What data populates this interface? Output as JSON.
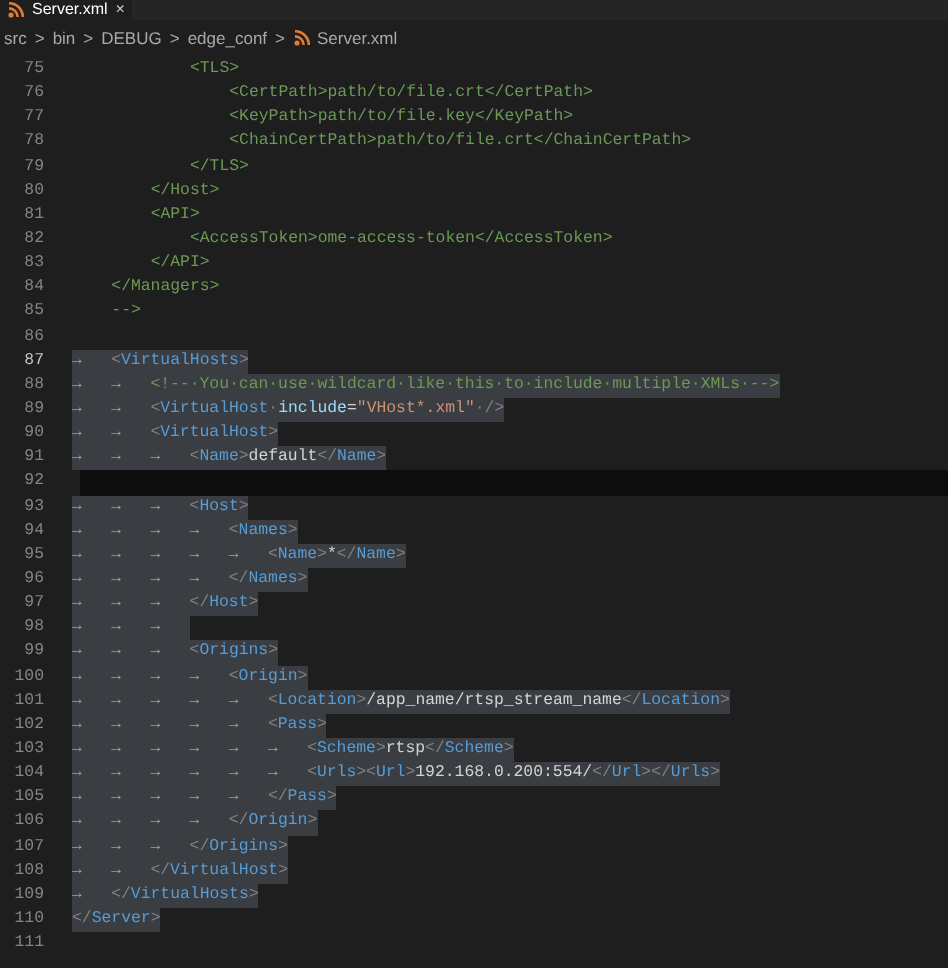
{
  "tab": {
    "label": "Server.xml",
    "close": "×"
  },
  "breadcrumb": {
    "parts": [
      "src",
      "bin",
      "DEBUG",
      "edge_conf"
    ],
    "separator": ">",
    "file": "Server.xml"
  },
  "editor": {
    "lines": [
      {
        "number": "75",
        "selected": false,
        "active": false,
        "highlighted": false,
        "segments": [
          {
            "kind": "comment",
            "text": "\t\t\t<TLS>"
          }
        ]
      },
      {
        "number": "76",
        "selected": false,
        "active": false,
        "highlighted": false,
        "segments": [
          {
            "kind": "comment",
            "text": "\t\t\t\t<CertPath>path/to/file.crt</CertPath>"
          }
        ]
      },
      {
        "number": "77",
        "selected": false,
        "active": false,
        "highlighted": false,
        "segments": [
          {
            "kind": "comment",
            "text": "\t\t\t\t<KeyPath>path/to/file.key</KeyPath>"
          }
        ]
      },
      {
        "number": "78",
        "selected": false,
        "active": false,
        "highlighted": false,
        "segments": [
          {
            "kind": "comment",
            "text": "\t\t\t\t<ChainCertPath>path/to/file.crt</ChainCertPath>"
          }
        ]
      },
      {
        "number": "79",
        "selected": false,
        "active": false,
        "highlighted": false,
        "segments": [
          {
            "kind": "comment",
            "text": "\t\t\t</TLS>"
          }
        ]
      },
      {
        "number": "80",
        "selected": false,
        "active": false,
        "highlighted": false,
        "segments": [
          {
            "kind": "comment",
            "text": "\t\t</Host>"
          }
        ]
      },
      {
        "number": "81",
        "selected": false,
        "active": false,
        "highlighted": false,
        "segments": [
          {
            "kind": "comment",
            "text": "\t\t<API>"
          }
        ]
      },
      {
        "number": "82",
        "selected": false,
        "active": false,
        "highlighted": false,
        "segments": [
          {
            "kind": "comment",
            "text": "\t\t\t<AccessToken>ome-access-token</AccessToken>"
          }
        ]
      },
      {
        "number": "83",
        "selected": false,
        "active": false,
        "highlighted": false,
        "segments": [
          {
            "kind": "comment",
            "text": "\t\t</API>"
          }
        ]
      },
      {
        "number": "84",
        "selected": false,
        "active": false,
        "highlighted": false,
        "segments": [
          {
            "kind": "comment",
            "text": "\t</Managers>"
          }
        ]
      },
      {
        "number": "85",
        "selected": false,
        "active": false,
        "highlighted": false,
        "segments": [
          {
            "kind": "comment",
            "text": "\t-->"
          }
        ]
      },
      {
        "number": "86",
        "selected": false,
        "active": false,
        "highlighted": false
      },
      {
        "number": "87",
        "selected": true,
        "active": true,
        "highlighted": false,
        "segments": [
          {
            "kind": "tab",
            "text": "→"
          },
          {
            "kind": "punct",
            "text": "<"
          },
          {
            "kind": "tag",
            "text": "VirtualHosts"
          },
          {
            "kind": "punct",
            "text": ">"
          }
        ]
      },
      {
        "number": "88",
        "selected": true,
        "active": false,
        "highlighted": false,
        "segments": [
          {
            "kind": "tab",
            "text": "→"
          },
          {
            "kind": "tab",
            "text": "→"
          },
          {
            "kind": "comment",
            "text": "<!--·You·can·use·wildcard·like·this·to·include·multiple·XMLs·-->"
          }
        ]
      },
      {
        "number": "89",
        "selected": true,
        "active": false,
        "highlighted": false,
        "segments": [
          {
            "kind": "tab",
            "text": "→"
          },
          {
            "kind": "tab",
            "text": "→"
          },
          {
            "kind": "punct",
            "text": "<"
          },
          {
            "kind": "tag",
            "text": "VirtualHost"
          },
          {
            "kind": "punct",
            "text": "·"
          },
          {
            "kind": "attr",
            "text": "include"
          },
          {
            "kind": "text",
            "text": "="
          },
          {
            "kind": "string",
            "text": "\"VHost*.xml\""
          },
          {
            "kind": "punct",
            "text": "·/>"
          }
        ]
      },
      {
        "number": "90",
        "selected": true,
        "active": false,
        "highlighted": false,
        "segments": [
          {
            "kind": "tab",
            "text": "→"
          },
          {
            "kind": "tab",
            "text": "→"
          },
          {
            "kind": "punct",
            "text": "<"
          },
          {
            "kind": "tag",
            "text": "VirtualHost"
          },
          {
            "kind": "punct",
            "text": ">"
          }
        ]
      },
      {
        "number": "91",
        "selected": true,
        "active": false,
        "highlighted": false,
        "segments": [
          {
            "kind": "tab",
            "text": "→"
          },
          {
            "kind": "tab",
            "text": "→"
          },
          {
            "kind": "tab",
            "text": "→"
          },
          {
            "kind": "punct",
            "text": "<"
          },
          {
            "kind": "tag",
            "text": "Name"
          },
          {
            "kind": "punct",
            "text": ">"
          },
          {
            "kind": "text",
            "text": "default"
          },
          {
            "kind": "punct",
            "text": "</"
          },
          {
            "kind": "tag",
            "text": "Name"
          },
          {
            "kind": "punct",
            "text": ">"
          }
        ]
      },
      {
        "number": "92",
        "selected": false,
        "active": false,
        "highlighted": true
      },
      {
        "number": "93",
        "selected": true,
        "active": false,
        "highlighted": false,
        "segments": [
          {
            "kind": "tab",
            "text": "→"
          },
          {
            "kind": "tab",
            "text": "→"
          },
          {
            "kind": "tab",
            "text": "→"
          },
          {
            "kind": "punct",
            "text": "<"
          },
          {
            "kind": "tag",
            "text": "Host"
          },
          {
            "kind": "punct",
            "text": ">"
          }
        ]
      },
      {
        "number": "94",
        "selected": true,
        "active": false,
        "highlighted": false,
        "segments": [
          {
            "kind": "tab",
            "text": "→"
          },
          {
            "kind": "tab",
            "text": "→"
          },
          {
            "kind": "tab",
            "text": "→"
          },
          {
            "kind": "tab",
            "text": "→"
          },
          {
            "kind": "punct",
            "text": "<"
          },
          {
            "kind": "tag",
            "text": "Names"
          },
          {
            "kind": "punct",
            "text": ">"
          }
        ]
      },
      {
        "number": "95",
        "selected": true,
        "active": false,
        "highlighted": false,
        "segments": [
          {
            "kind": "tab",
            "text": "→"
          },
          {
            "kind": "tab",
            "text": "→"
          },
          {
            "kind": "tab",
            "text": "→"
          },
          {
            "kind": "tab",
            "text": "→"
          },
          {
            "kind": "tab",
            "text": "→"
          },
          {
            "kind": "punct",
            "text": "<"
          },
          {
            "kind": "tag",
            "text": "Name"
          },
          {
            "kind": "punct",
            "text": ">"
          },
          {
            "kind": "text",
            "text": "*"
          },
          {
            "kind": "punct",
            "text": "</"
          },
          {
            "kind": "tag",
            "text": "Name"
          },
          {
            "kind": "punct",
            "text": ">"
          }
        ]
      },
      {
        "number": "96",
        "selected": true,
        "active": false,
        "highlighted": false,
        "segments": [
          {
            "kind": "tab",
            "text": "→"
          },
          {
            "kind": "tab",
            "text": "→"
          },
          {
            "kind": "tab",
            "text": "→"
          },
          {
            "kind": "tab",
            "text": "→"
          },
          {
            "kind": "punct",
            "text": "</"
          },
          {
            "kind": "tag",
            "text": "Names"
          },
          {
            "kind": "punct",
            "text": ">"
          }
        ]
      },
      {
        "number": "97",
        "selected": true,
        "active": false,
        "highlighted": false,
        "segments": [
          {
            "kind": "tab",
            "text": "→"
          },
          {
            "kind": "tab",
            "text": "→"
          },
          {
            "kind": "tab",
            "text": "→"
          },
          {
            "kind": "punct",
            "text": "</"
          },
          {
            "kind": "tag",
            "text": "Host"
          },
          {
            "kind": "punct",
            "text": ">"
          }
        ]
      },
      {
        "number": "98",
        "selected": true,
        "active": false,
        "highlighted": false,
        "segments": [
          {
            "kind": "tab",
            "text": "→"
          },
          {
            "kind": "tab",
            "text": "→"
          },
          {
            "kind": "tab",
            "text": "→"
          }
        ]
      },
      {
        "number": "99",
        "selected": true,
        "active": false,
        "highlighted": false,
        "segments": [
          {
            "kind": "tab",
            "text": "→"
          },
          {
            "kind": "tab",
            "text": "→"
          },
          {
            "kind": "tab",
            "text": "→"
          },
          {
            "kind": "punct",
            "text": "<"
          },
          {
            "kind": "tag",
            "text": "Origins"
          },
          {
            "kind": "punct",
            "text": ">"
          }
        ]
      },
      {
        "number": "100",
        "selected": true,
        "active": false,
        "highlighted": false,
        "segments": [
          {
            "kind": "tab",
            "text": "→"
          },
          {
            "kind": "tab",
            "text": "→"
          },
          {
            "kind": "tab",
            "text": "→"
          },
          {
            "kind": "tab",
            "text": "→"
          },
          {
            "kind": "punct",
            "text": "<"
          },
          {
            "kind": "tag",
            "text": "Origin"
          },
          {
            "kind": "punct",
            "text": ">"
          }
        ]
      },
      {
        "number": "101",
        "selected": true,
        "active": false,
        "highlighted": false,
        "segments": [
          {
            "kind": "tab",
            "text": "→"
          },
          {
            "kind": "tab",
            "text": "→"
          },
          {
            "kind": "tab",
            "text": "→"
          },
          {
            "kind": "tab",
            "text": "→"
          },
          {
            "kind": "tab",
            "text": "→"
          },
          {
            "kind": "punct",
            "text": "<"
          },
          {
            "kind": "tag",
            "text": "Location"
          },
          {
            "kind": "punct",
            "text": ">"
          },
          {
            "kind": "text",
            "text": "/app_name/rtsp_stream_name"
          },
          {
            "kind": "punct",
            "text": "</"
          },
          {
            "kind": "tag",
            "text": "Location"
          },
          {
            "kind": "punct",
            "text": ">"
          }
        ]
      },
      {
        "number": "102",
        "selected": true,
        "active": false,
        "highlighted": false,
        "segments": [
          {
            "kind": "tab",
            "text": "→"
          },
          {
            "kind": "tab",
            "text": "→"
          },
          {
            "kind": "tab",
            "text": "→"
          },
          {
            "kind": "tab",
            "text": "→"
          },
          {
            "kind": "tab",
            "text": "→"
          },
          {
            "kind": "punct",
            "text": "<"
          },
          {
            "kind": "tag",
            "text": "Pass"
          },
          {
            "kind": "punct",
            "text": ">"
          }
        ]
      },
      {
        "number": "103",
        "selected": true,
        "active": false,
        "highlighted": false,
        "segments": [
          {
            "kind": "tab",
            "text": "→"
          },
          {
            "kind": "tab",
            "text": "→"
          },
          {
            "kind": "tab",
            "text": "→"
          },
          {
            "kind": "tab",
            "text": "→"
          },
          {
            "kind": "tab",
            "text": "→"
          },
          {
            "kind": "tab",
            "text": "→"
          },
          {
            "kind": "punct",
            "text": "<"
          },
          {
            "kind": "tag",
            "text": "Scheme"
          },
          {
            "kind": "punct",
            "text": ">"
          },
          {
            "kind": "text",
            "text": "rtsp"
          },
          {
            "kind": "punct",
            "text": "</"
          },
          {
            "kind": "tag",
            "text": "Scheme"
          },
          {
            "kind": "punct",
            "text": ">"
          }
        ]
      },
      {
        "number": "104",
        "selected": true,
        "active": false,
        "highlighted": false,
        "segments": [
          {
            "kind": "tab",
            "text": "→"
          },
          {
            "kind": "tab",
            "text": "→"
          },
          {
            "kind": "tab",
            "text": "→"
          },
          {
            "kind": "tab",
            "text": "→"
          },
          {
            "kind": "tab",
            "text": "→"
          },
          {
            "kind": "tab",
            "text": "→"
          },
          {
            "kind": "punct",
            "text": "<"
          },
          {
            "kind": "tag",
            "text": "Urls"
          },
          {
            "kind": "punct",
            "text": "><"
          },
          {
            "kind": "tag",
            "text": "Url"
          },
          {
            "kind": "punct",
            "text": ">"
          },
          {
            "kind": "text",
            "text": "192.168.0.200:554/"
          },
          {
            "kind": "punct",
            "text": "</"
          },
          {
            "kind": "tag",
            "text": "Url"
          },
          {
            "kind": "punct",
            "text": "></"
          },
          {
            "kind": "tag",
            "text": "Urls"
          },
          {
            "kind": "punct",
            "text": ">"
          }
        ]
      },
      {
        "number": "105",
        "selected": true,
        "active": false,
        "highlighted": false,
        "segments": [
          {
            "kind": "tab",
            "text": "→"
          },
          {
            "kind": "tab",
            "text": "→"
          },
          {
            "kind": "tab",
            "text": "→"
          },
          {
            "kind": "tab",
            "text": "→"
          },
          {
            "kind": "tab",
            "text": "→"
          },
          {
            "kind": "punct",
            "text": "</"
          },
          {
            "kind": "tag",
            "text": "Pass"
          },
          {
            "kind": "punct",
            "text": ">"
          }
        ]
      },
      {
        "number": "106",
        "selected": true,
        "active": false,
        "highlighted": false,
        "segments": [
          {
            "kind": "tab",
            "text": "→"
          },
          {
            "kind": "tab",
            "text": "→"
          },
          {
            "kind": "tab",
            "text": "→"
          },
          {
            "kind": "tab",
            "text": "→"
          },
          {
            "kind": "punct",
            "text": "</"
          },
          {
            "kind": "tag",
            "text": "Origin"
          },
          {
            "kind": "punct",
            "text": ">"
          }
        ]
      },
      {
        "number": "107",
        "selected": true,
        "active": false,
        "highlighted": false,
        "segments": [
          {
            "kind": "tab",
            "text": "→"
          },
          {
            "kind": "tab",
            "text": "→"
          },
          {
            "kind": "tab",
            "text": "→"
          },
          {
            "kind": "punct",
            "text": "</"
          },
          {
            "kind": "tag",
            "text": "Origins"
          },
          {
            "kind": "punct",
            "text": ">"
          }
        ]
      },
      {
        "number": "108",
        "selected": true,
        "active": false,
        "highlighted": false,
        "segments": [
          {
            "kind": "tab",
            "text": "→"
          },
          {
            "kind": "tab",
            "text": "→"
          },
          {
            "kind": "punct",
            "text": "</"
          },
          {
            "kind": "tag",
            "text": "VirtualHost"
          },
          {
            "kind": "punct",
            "text": ">"
          }
        ]
      },
      {
        "number": "109",
        "selected": true,
        "active": false,
        "highlighted": false,
        "segments": [
          {
            "kind": "tab",
            "text": "→"
          },
          {
            "kind": "punct",
            "text": "</"
          },
          {
            "kind": "tag",
            "text": "VirtualHosts"
          },
          {
            "kind": "punct",
            "text": ">"
          }
        ]
      },
      {
        "number": "110",
        "selected": true,
        "active": false,
        "highlighted": false,
        "segments": [
          {
            "kind": "punct",
            "text": "</"
          },
          {
            "kind": "tag",
            "text": "Server"
          },
          {
            "kind": "punct",
            "text": ">"
          }
        ]
      },
      {
        "number": "111",
        "selected": false,
        "active": false,
        "highlighted": false
      }
    ]
  }
}
